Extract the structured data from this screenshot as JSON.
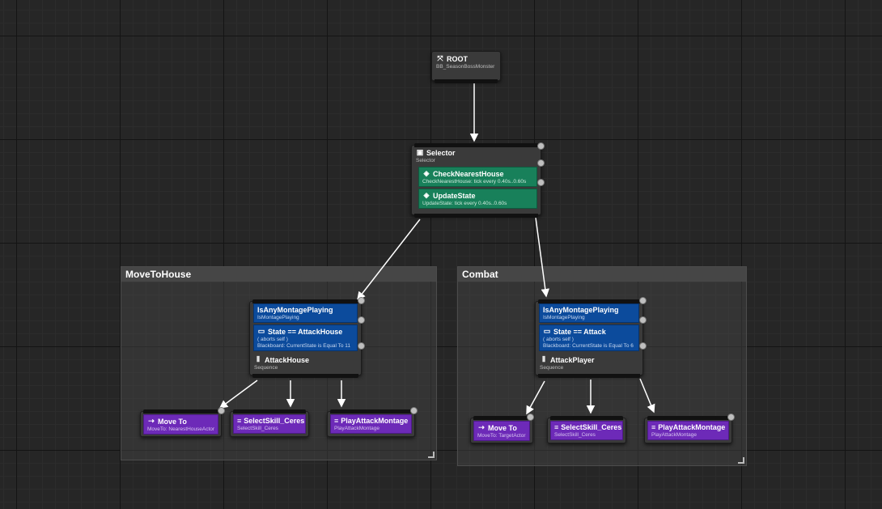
{
  "root": {
    "title": "ROOT",
    "subtitle": "BB_SeasonBossMonster"
  },
  "selector": {
    "title": "Selector",
    "subtitle": "Selector",
    "services": [
      {
        "title": "CheckNearestHouse",
        "subtitle": "CheckNearestHouse: tick every 0.40s..0.60s"
      },
      {
        "title": "UpdateState",
        "subtitle": "UpdateState: tick every 0.40s..0.60s"
      }
    ]
  },
  "comments": {
    "move_to_house": "MoveToHouse",
    "combat": "Combat"
  },
  "left_sequence": {
    "decorator1": {
      "title": "IsAnyMontagePlaying",
      "subtitle": "IsMontagePlaying"
    },
    "decorator2": {
      "title": "State == AttackHouse",
      "note": "( aborts self )",
      "subtitle": "Blackboard: CurrentState is Equal To 11"
    },
    "title": "AttackHouse",
    "subtitle": "Sequence"
  },
  "right_sequence": {
    "decorator1": {
      "title": "IsAnyMontagePlaying",
      "subtitle": "IsMontagePlaying"
    },
    "decorator2": {
      "title": "State == Attack",
      "note": "( aborts self )",
      "subtitle": "Blackboard: CurrentState is Equal To 6"
    },
    "title": "AttackPlayer",
    "subtitle": "Sequence"
  },
  "left_tasks": [
    {
      "title": "Move To",
      "subtitle": "MoveTo: NearestHouseActor"
    },
    {
      "title": "SelectSkill_Ceres",
      "subtitle": "SelectSkill_Ceres"
    },
    {
      "title": "PlayAttackMontage",
      "subtitle": "PlayAttackMontage"
    }
  ],
  "right_tasks": [
    {
      "title": "Move To",
      "subtitle": "MoveTo: TargetActor"
    },
    {
      "title": "SelectSkill_Ceres",
      "subtitle": "SelectSkill_Ceres"
    },
    {
      "title": "PlayAttackMontage",
      "subtitle": "PlayAttackMontage"
    }
  ],
  "icons": {
    "root": "root-icon",
    "selector": "selector-icon",
    "service": "service-icon",
    "blackboard": "blackboard-icon",
    "sequence": "sequence-icon",
    "moveto": "move-to-icon",
    "task": "task-icon"
  },
  "colors": {
    "service": "#18805a",
    "decorator": "#0c4b9c",
    "task": "#6d2ab8",
    "node": "#3a3a3a",
    "comment_header": "#464646",
    "background": "#262626"
  }
}
